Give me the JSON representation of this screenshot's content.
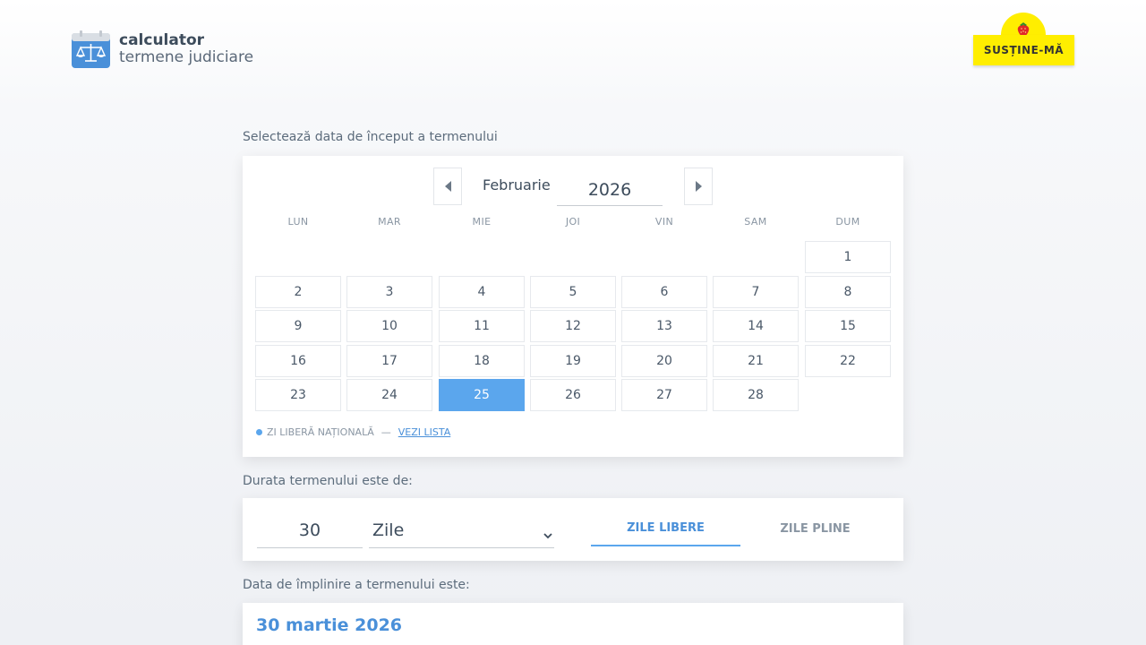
{
  "brand": {
    "title": "calculator",
    "subtitle": "termene judiciare",
    "icon": "calendar-scales-icon",
    "accent": "#4a90d9"
  },
  "support": {
    "label": "SUSȚINE-MĂ",
    "icon": "strawberry-icon",
    "color": "#ffee00"
  },
  "start_date": {
    "label": "Selectează data de început a termenului",
    "month": "Februarie",
    "year": "2026",
    "weekdays": [
      "LUN",
      "MAR",
      "MIE",
      "JOI",
      "VIN",
      "SAM",
      "DUM"
    ],
    "days": [
      "1",
      "2",
      "3",
      "4",
      "5",
      "6",
      "7",
      "8",
      "9",
      "10",
      "11",
      "12",
      "13",
      "14",
      "15",
      "16",
      "17",
      "18",
      "19",
      "20",
      "21",
      "22",
      "23",
      "24",
      "25",
      "26",
      "27",
      "28"
    ],
    "selected_day": "25",
    "legend_text": "ZI LIBERĂ NAȚIONALĂ",
    "legend_separator": "—",
    "legend_link": "VEZI LISTA",
    "selected_color": "#5ba6ed"
  },
  "duration": {
    "label": "Durata termenului este de:",
    "value": "30",
    "unit": "Zile",
    "tabs": [
      {
        "label": "ZILE LIBERE",
        "active": true
      },
      {
        "label": "ZILE PLINE",
        "active": false
      }
    ]
  },
  "result": {
    "label": "Data de împlinire a termenului este:",
    "value": "30 martie 2026"
  }
}
